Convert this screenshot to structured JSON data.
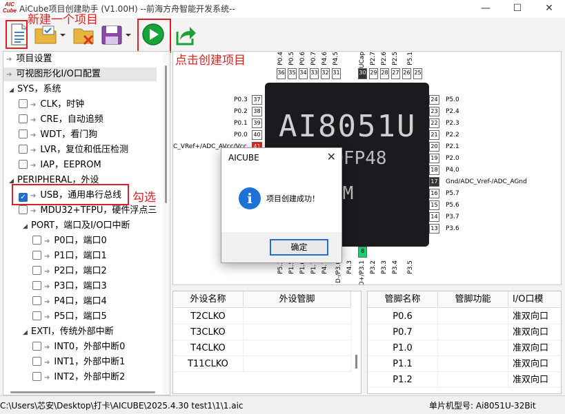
{
  "app": {
    "logo_top": "AIC",
    "logo_bottom": "Cube",
    "title": "AiCube项目创建助手 (V1.00H) --前海方舟智能开发系统--"
  },
  "window_controls": {
    "minimize": "—",
    "maximize": "☐",
    "close": "✕"
  },
  "annotations": {
    "new_project": "新建一个项目",
    "click_create": "点击创建项目",
    "check": "勾选"
  },
  "tree": {
    "items": [
      {
        "label": "项目设置"
      },
      {
        "label": "可视图形化I/O口配置"
      },
      {
        "label": "SYS，系统"
      },
      {
        "label": "CLK，时钟"
      },
      {
        "label": "CRE，自动追频"
      },
      {
        "label": "WDT，看门狗"
      },
      {
        "label": "LVR，复位和低压检测"
      },
      {
        "label": "IAP，EEPROM"
      },
      {
        "label": "PERIPHERAL，外设"
      },
      {
        "label": "USB，通用串行总线"
      },
      {
        "label": "MDU32+TFPU，硬件浮点三"
      },
      {
        "label": "PORT，端口及I/O口中断"
      },
      {
        "label": "P0口，端口0"
      },
      {
        "label": "P1口，端口1"
      },
      {
        "label": "P2口，端口2"
      },
      {
        "label": "P3口，端口3"
      },
      {
        "label": "P4口，端口4"
      },
      {
        "label": "P5口，端口5"
      },
      {
        "label": "EXTI，传统外部中断"
      },
      {
        "label": "INT0，外部中断0"
      },
      {
        "label": "INT1，外部中断1"
      },
      {
        "label": "INT2，外部中断2"
      }
    ]
  },
  "chip": {
    "line1": "AI8051U",
    "line2": "34H1LQFP48",
    "line3": "@108M",
    "top_pins": [
      "P0.4",
      "P0.5",
      "P0.6",
      "P0.7",
      "P4.6",
      "P4.5",
      "UCap",
      "P2.7",
      "P2.6",
      "P2.5",
      "P5.1"
    ],
    "top_nums": [
      "36",
      "35",
      "34",
      "33",
      "32",
      "31",
      "30",
      "29",
      "28",
      "27",
      "26",
      "25"
    ],
    "left_pins": [
      "P0.3",
      "P0.2",
      "P0.1",
      "P0.0",
      "C_VRef+/ADC_AVcc/Vcc"
    ],
    "left_nums": [
      "37",
      "38",
      "39",
      "40",
      "41"
    ],
    "right_nums": [
      "24",
      "23",
      "22",
      "21",
      "20",
      "19",
      "18",
      "17",
      "16",
      "15",
      "14",
      "13"
    ],
    "right_pins": [
      "P5.0",
      "P2.4",
      "P2.3",
      "P2.2",
      "P2.1",
      "P2.0",
      "P4.0",
      "Gnd/ADC_Vref-/ADC_AGnd",
      "P5.7",
      "P5.6",
      "P3.7",
      "P3.6"
    ],
    "bottom_pins": [
      "P5.3",
      "P1.5",
      "P1.6",
      "P1.7",
      "P4.7",
      "D-/P3.0",
      "P4.3",
      "D+/P3.1",
      "P3.2",
      "P3.3",
      "P3.4",
      "P3.5"
    ],
    "bottom_nums": [
      "8"
    ]
  },
  "peripheral_table": {
    "headers": [
      "外设名称",
      "外设管脚"
    ],
    "rows": [
      "T2CLKO",
      "T3CLKO",
      "T4CLKO",
      "T11CLKO"
    ]
  },
  "pin_table": {
    "headers": [
      "管脚名称",
      "管脚功能",
      "I/O口模"
    ],
    "rows": [
      {
        "name": "P0.6",
        "mode": "准双向口"
      },
      {
        "name": "P0.7",
        "mode": "准双向口"
      },
      {
        "name": "P1.0",
        "mode": "准双向口"
      },
      {
        "name": "P1.1",
        "mode": "准双向口"
      },
      {
        "name": "P1.2",
        "mode": "准双向口"
      }
    ]
  },
  "status": {
    "path": "C:\\Users\\芯安\\Desktop\\打卡\\AICUBE\\2025.4.30 test1\\1\\1.aic",
    "mcu": "单片机型号:  Ai8051U-32Bit"
  },
  "dialog": {
    "title": "AICUBE",
    "message": "项目创建成功！",
    "ok": "确定",
    "close": "✕",
    "icon": "i"
  },
  "colors": {
    "accent": "#1e6fd0",
    "annotation": "#e02020",
    "run_green": "#1aa33a",
    "pin_red": "#e82020",
    "pin_green": "#18d070"
  }
}
